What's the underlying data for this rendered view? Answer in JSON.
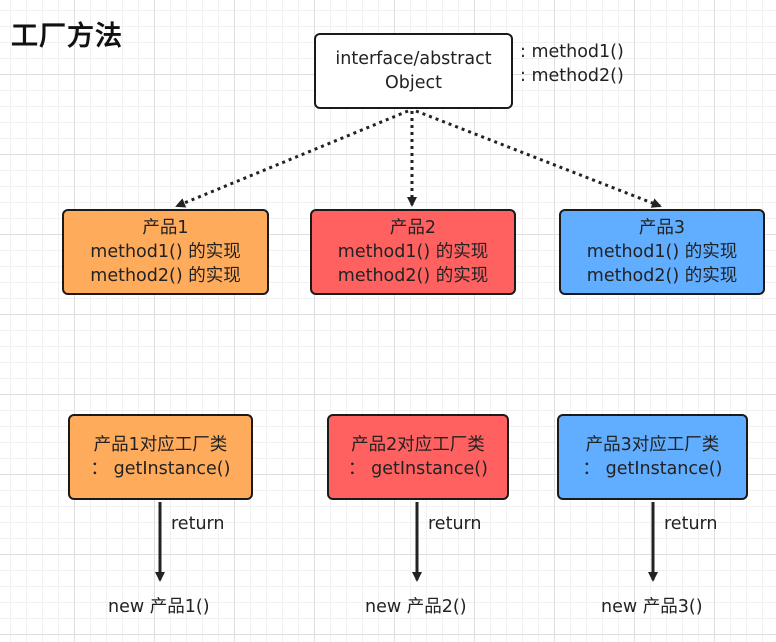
{
  "title": "工厂方法",
  "interface": {
    "line1": "interface/abstract",
    "line2": "Object",
    "methods": [
      ": method1()",
      ": method2()"
    ]
  },
  "products": [
    {
      "name": "产品1",
      "m1": "method1() 的实现",
      "m2": "method2() 的实现",
      "color": "#ffab5c"
    },
    {
      "name": "产品2",
      "m1": "method1() 的实现",
      "m2": "method2() 的实现",
      "color": "#ff6161"
    },
    {
      "name": "产品3",
      "m1": "method1() 的实现",
      "m2": "method2() 的实现",
      "color": "#61adff"
    }
  ],
  "factories": [
    {
      "line1": "产品1对应工厂类",
      "line2": "：  getInstance()",
      "return_label": "return",
      "result": "new 产品1()"
    },
    {
      "line1": "产品2对应工厂类",
      "line2": "：  getInstance()",
      "return_label": "return",
      "result": "new 产品2()"
    },
    {
      "line1": "产品3对应工厂类",
      "line2": "：  getInstance()",
      "return_label": "return",
      "result": "new 产品3()"
    }
  ]
}
